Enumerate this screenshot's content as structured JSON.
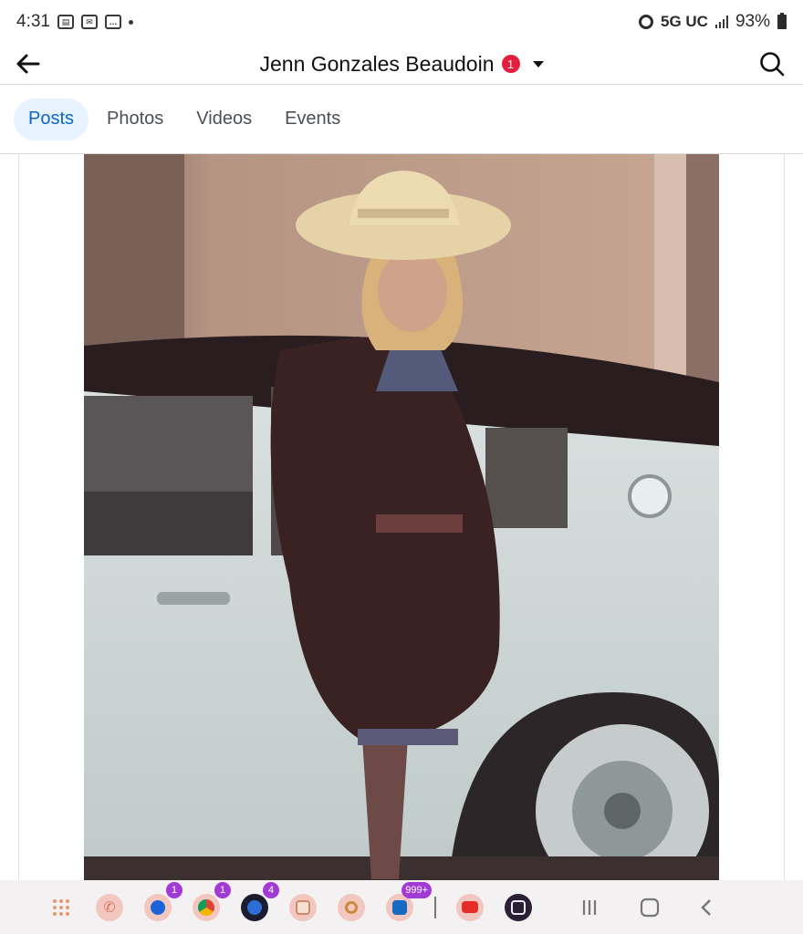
{
  "status_bar": {
    "time": "4:31",
    "network": "5G UC",
    "battery": "93%"
  },
  "header": {
    "title": "Jenn Gonzales Beaudoin",
    "notification_count": "1"
  },
  "tabs": [
    {
      "label": "Posts",
      "active": true
    },
    {
      "label": "Photos",
      "active": false
    },
    {
      "label": "Videos",
      "active": false
    },
    {
      "label": "Events",
      "active": false
    }
  ],
  "taskbar": {
    "apps": [
      {
        "name": "app-drawer",
        "badge": ""
      },
      {
        "name": "phone",
        "badge": ""
      },
      {
        "name": "messages",
        "badge": "1"
      },
      {
        "name": "chrome",
        "badge": "1"
      },
      {
        "name": "facebook-app",
        "badge": "4"
      },
      {
        "name": "gallery",
        "badge": ""
      },
      {
        "name": "camera",
        "badge": ""
      },
      {
        "name": "outlook",
        "badge": "999+"
      },
      {
        "name": "youtube",
        "badge": ""
      },
      {
        "name": "calculator",
        "badge": ""
      }
    ]
  },
  "colors": {
    "accent": "#0b66c2",
    "tab_active_bg": "#e7f3ff",
    "badge_red": "#e41e3f",
    "taskbar_badge": "#a23bd6"
  }
}
